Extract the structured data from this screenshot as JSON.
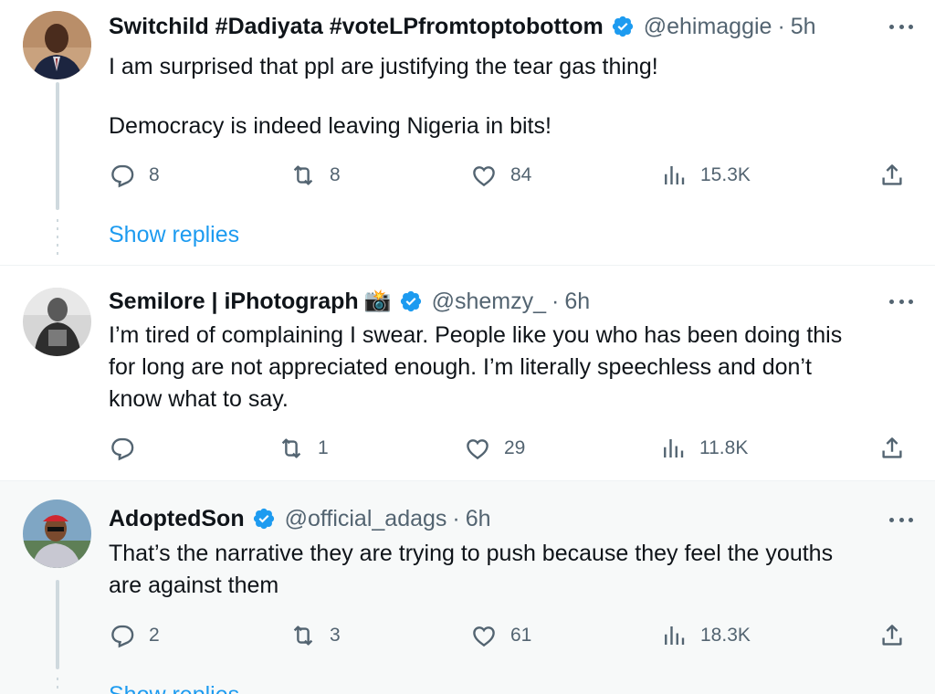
{
  "tweets": [
    {
      "name": "Switchild #Dadiyata #voteLPfromtoptobottom",
      "handle": "@ehimaggie",
      "separator": "·",
      "time": "5h",
      "text_lines": [
        "I am surprised that ppl are justifying the tear gas thing!",
        "",
        "Democracy is indeed leaving Nigeria in bits!"
      ],
      "replies": "8",
      "retweets": "8",
      "likes": "84",
      "views": "15.3K",
      "show_replies": "Show replies"
    },
    {
      "name": "Semilore | iPhotograph",
      "name_emoji": "📸",
      "handle": "@shemzy_",
      "separator": "·",
      "time": "6h",
      "text_lines": [
        "I’m tired of complaining I swear. People like you who has been doing this",
        "for long are not appreciated enough. I’m literally speechless and don’t",
        "know what to say."
      ],
      "replies": "",
      "retweets": "1",
      "likes": "29",
      "views": "11.8K"
    },
    {
      "name": "AdoptedSon",
      "handle": "@official_adags",
      "separator": "·",
      "time": "6h",
      "text_lines": [
        "That’s the narrative they are trying to push because they feel the youths",
        "are against them"
      ],
      "replies": "2",
      "retweets": "3",
      "likes": "61",
      "views": "18.3K",
      "show_replies": "Show replies"
    }
  ],
  "colors": {
    "verified": "#1d9bf0",
    "muted": "#536471",
    "link": "#1d9bf0",
    "highlight_bg": "#f7f9f9"
  },
  "icons": [
    "verified-badge-icon",
    "more-icon",
    "reply-icon",
    "retweet-icon",
    "like-icon",
    "views-icon",
    "share-icon"
  ]
}
